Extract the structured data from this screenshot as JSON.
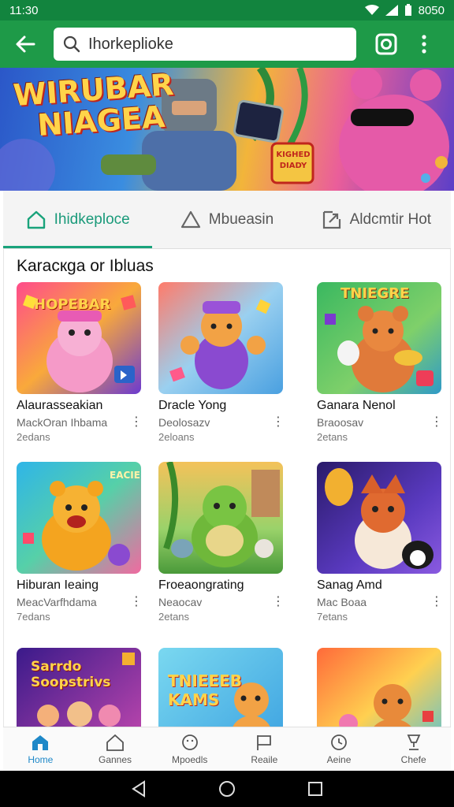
{
  "status": {
    "time": "11:30",
    "battery": "8050"
  },
  "search": {
    "value": "Ihorkeplioke"
  },
  "banner": {
    "title_line1": "WIRUBAR",
    "title_line2": "NIAGEA",
    "badge": "KIGHED DIADY"
  },
  "tabs": [
    {
      "label": "Ihidkeploce",
      "icon": "home-icon"
    },
    {
      "label": "Mbueasin",
      "icon": "triangle-icon"
    },
    {
      "label": "Aldcmtir Hot",
      "icon": "share-icon"
    }
  ],
  "section": {
    "title": "Karacкga or Ibluas"
  },
  "cards": [
    {
      "title": "Alaurasseakian",
      "sub": "MackOran Ihbama",
      "meta": "2edans",
      "art": "HOPEBAR"
    },
    {
      "title": "Dracle Yong",
      "sub": "Deolosazv",
      "meta": "2eloans",
      "art": ""
    },
    {
      "title": "Ganara Nenol",
      "sub": "Braoosav",
      "meta": "2etans",
      "art": "TNIEGRE"
    },
    {
      "title": "Hiburan Ieaing",
      "sub": "MeacVarfhdama",
      "meta": "7edans",
      "art": "EACIE"
    },
    {
      "title": "Froeaongrating",
      "sub": "Neaocav",
      "meta": "2etans",
      "art": ""
    },
    {
      "title": "Sanag Amd",
      "sub": "Mac Boaa",
      "meta": "7etans",
      "art": ""
    },
    {
      "title": "",
      "sub": "",
      "meta": "",
      "art": "Sarrdo Soopstrivs"
    },
    {
      "title": "",
      "sub": "",
      "meta": "",
      "art": "TNIEEEB KAMS"
    },
    {
      "title": "",
      "sub": "",
      "meta": "",
      "art": ""
    }
  ],
  "nav": [
    {
      "label": "Home",
      "icon": "home-icon"
    },
    {
      "label": "Gannes",
      "icon": "games-icon"
    },
    {
      "label": "Mpoedls",
      "icon": "smile-icon"
    },
    {
      "label": "Reaile",
      "icon": "flag-icon"
    },
    {
      "label": "Aeine",
      "icon": "clock-icon"
    },
    {
      "label": "Chefe",
      "icon": "trophy-icon"
    }
  ],
  "colors": {
    "status_bar": "#12843e",
    "app_bar": "#1e9a48",
    "accent_tab": "#19a37b",
    "nav_active": "#1e88c8"
  }
}
